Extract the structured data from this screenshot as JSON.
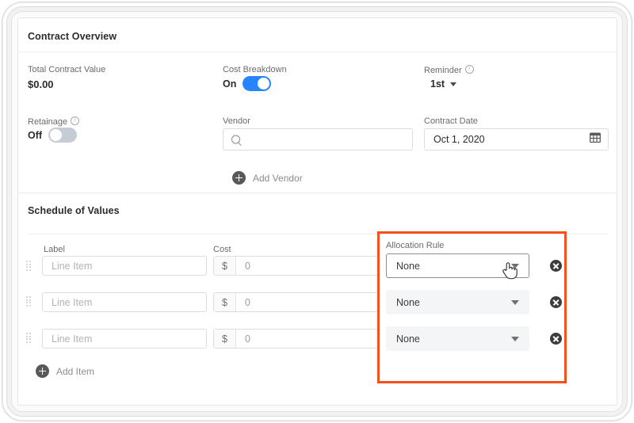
{
  "card": {
    "sections": [
      {
        "id": "contract-overview",
        "title": "Contract Overview"
      },
      {
        "id": "schedule-of-values",
        "title": "Schedule of Values"
      }
    ]
  },
  "contract_overview": {
    "total_contract_value": {
      "label": "Total Contract Value",
      "value": "$0.00"
    },
    "cost_breakdown": {
      "label": "Cost Breakdown",
      "state_text": "On",
      "state": "on"
    },
    "reminder": {
      "label": "Reminder",
      "has_info_icon": true,
      "selected": "1st",
      "icon": "chevron-down-icon"
    },
    "retainage": {
      "label": "Retainage",
      "has_info_icon": true,
      "state_text": "Off",
      "state": "off"
    },
    "vendor": {
      "label": "Vendor",
      "placeholder": "",
      "value": "",
      "icon": "search-icon"
    },
    "add_vendor": {
      "label": "Add Vendor",
      "icon": "plus-circle-icon"
    },
    "contract_date": {
      "label": "Contract Date",
      "value": "Oct 1, 2020",
      "icon": "calendar-icon"
    }
  },
  "schedule_of_values": {
    "columns": {
      "label": "Label",
      "cost": "Cost",
      "allocation_rule": "Allocation Rule"
    },
    "rows": [
      {
        "label_placeholder": "Line Item",
        "cost_prefix": "$",
        "cost_value": "0",
        "allocation_rule": "None",
        "hovered": true
      },
      {
        "label_placeholder": "Line Item",
        "cost_prefix": "$",
        "cost_value": "0",
        "allocation_rule": "None",
        "hovered": false
      },
      {
        "label_placeholder": "Line Item",
        "cost_prefix": "$",
        "cost_value": "0",
        "allocation_rule": "None",
        "hovered": false
      }
    ],
    "add_item": {
      "label": "Add Item",
      "icon": "plus-circle-icon"
    }
  },
  "annotation": {
    "highlight_color": "#f4511e",
    "target": "allocation-rule-column"
  },
  "theme": {
    "accent_blue": "#2684ff",
    "toggle_off": "#c6ccd3",
    "text_primary": "#2b2b2b",
    "text_secondary": "#6b6b6b",
    "placeholder": "#b3b3b3",
    "field_bg": "#f4f5f7",
    "border": "#dddddd"
  },
  "cursor": {
    "type": "pointer-hand-cursor"
  }
}
